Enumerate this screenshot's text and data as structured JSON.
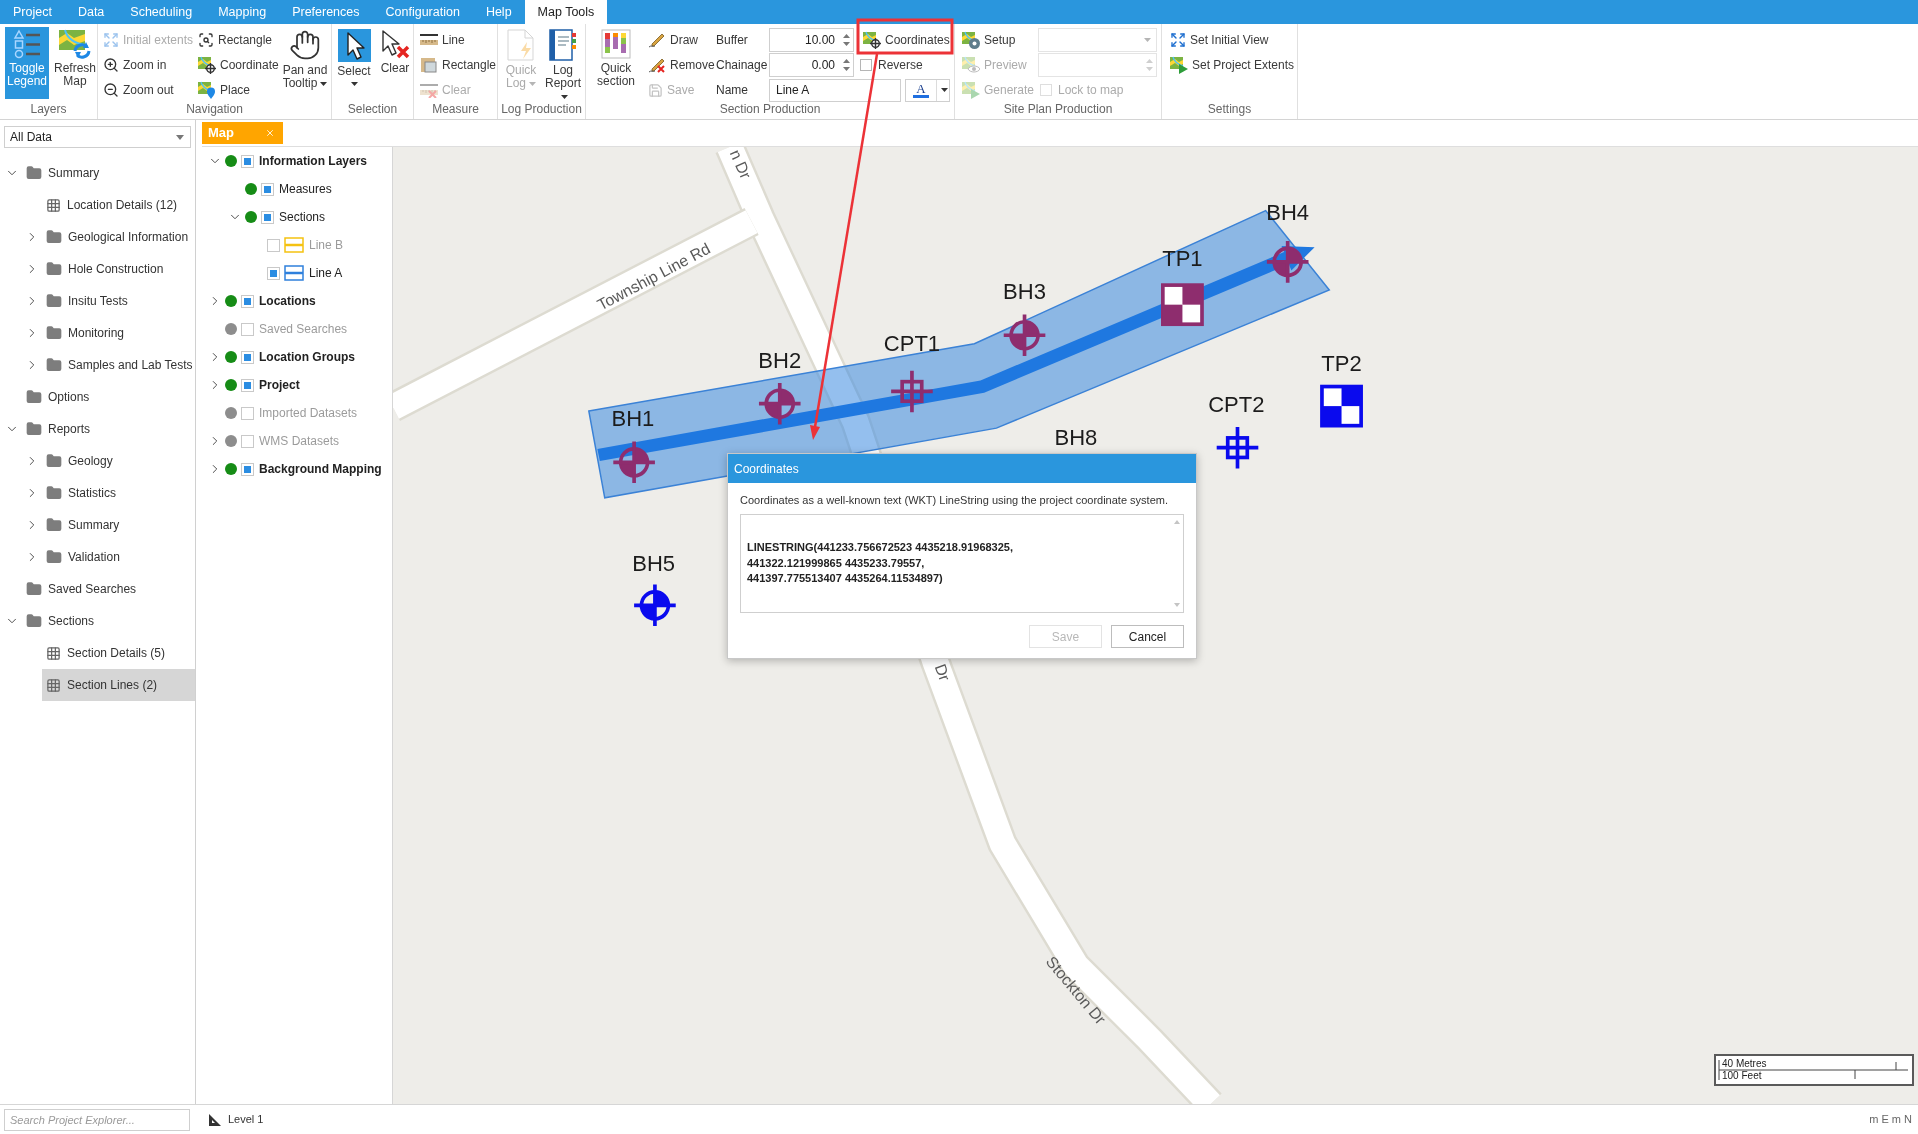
{
  "menu_tabs": [
    {
      "label": "Project",
      "selected": false
    },
    {
      "label": "Data",
      "selected": false
    },
    {
      "label": "Scheduling",
      "selected": false
    },
    {
      "label": "Mapping",
      "selected": false
    },
    {
      "label": "Preferences",
      "selected": false
    },
    {
      "label": "Configuration",
      "selected": false
    },
    {
      "label": "Help",
      "selected": false
    },
    {
      "label": "Map Tools",
      "selected": true
    }
  ],
  "ribbon": {
    "layers": {
      "label": "Layers",
      "toggle_legend": {
        "label": "Toggle Legend",
        "selected": true
      },
      "refresh_map": {
        "label": "Refresh Map"
      }
    },
    "navigation": {
      "label": "Navigation",
      "initial_extents": {
        "label": "Initial extents",
        "disabled": true
      },
      "zoom_in": {
        "label": "Zoom in"
      },
      "zoom_out": {
        "label": "Zoom out"
      },
      "rectangle": {
        "label": "Rectangle"
      },
      "coordinate": {
        "label": "Coordinate"
      },
      "place": {
        "label": "Place"
      },
      "pan_and_tooltip": {
        "label": "Pan and Tooltip"
      }
    },
    "selection": {
      "label": "Selection",
      "select": {
        "label": "Select",
        "selected": true
      },
      "clear": {
        "label": "Clear"
      }
    },
    "measure": {
      "label": "Measure",
      "line": {
        "label": "Line"
      },
      "rectangle": {
        "label": "Rectangle"
      },
      "clear": {
        "label": "Clear",
        "disabled": true
      }
    },
    "log_production": {
      "label": "Log Production",
      "quick_log": {
        "label": "Quick Log",
        "disabled": true
      },
      "log_report": {
        "label": "Log Report"
      }
    },
    "section_production": {
      "label": "Section Production",
      "quick_section": {
        "label": "Quick section"
      },
      "draw": {
        "label": "Draw"
      },
      "remove": {
        "label": "Remove"
      },
      "save": {
        "label": "Save",
        "disabled": true
      },
      "buffer": {
        "label": "Buffer",
        "value": "10.00"
      },
      "chainage": {
        "label": "Chainage",
        "value": "0.00"
      },
      "name": {
        "label": "Name",
        "value": "Line A"
      },
      "font_color": {
        "label": "A"
      },
      "coordinates": {
        "label": "Coordinates"
      },
      "reverse": {
        "label": "Reverse",
        "checked": false
      }
    },
    "site_plan_production": {
      "label": "Site Plan Production",
      "setup": {
        "label": "Setup"
      },
      "preview": {
        "label": "Preview",
        "disabled": true
      },
      "generate": {
        "label": "Generate",
        "disabled": true
      },
      "dropdown": {
        "disabled": true
      },
      "number_field": {
        "disabled": true
      },
      "lock_to_map": {
        "label": "Lock to map",
        "checked": false,
        "disabled": true
      }
    },
    "settings": {
      "label": "Settings",
      "set_initial_view": {
        "label": "Set Initial View"
      },
      "set_project_extents": {
        "label": "Set Project Extents"
      }
    }
  },
  "explorer": {
    "filter": {
      "value": "All Data"
    },
    "tree": [
      {
        "label": "Summary",
        "kind": "folder",
        "selected": false,
        "expanded": true,
        "children": [
          {
            "label": "Location Details (12)",
            "kind": "table",
            "selected": false
          },
          {
            "label": "Geological Information",
            "kind": "folder",
            "selected": false,
            "expanded": false
          },
          {
            "label": "Hole Construction",
            "kind": "folder",
            "selected": false,
            "expanded": false
          },
          {
            "label": "Insitu Tests",
            "kind": "folder",
            "selected": false,
            "expanded": false
          },
          {
            "label": "Monitoring",
            "kind": "folder",
            "selected": false,
            "expanded": false
          },
          {
            "label": "Samples and Lab Tests",
            "kind": "folder",
            "selected": false,
            "expanded": false
          }
        ]
      },
      {
        "label": "Options",
        "kind": "folder",
        "selected": false
      },
      {
        "label": "Reports",
        "kind": "folder",
        "selected": false,
        "expanded": true,
        "children": [
          {
            "label": "Geology",
            "kind": "folder",
            "selected": false,
            "expanded": false
          },
          {
            "label": "Statistics",
            "kind": "folder",
            "selected": false,
            "expanded": false
          },
          {
            "label": "Summary",
            "kind": "folder",
            "selected": false,
            "expanded": false
          },
          {
            "label": "Validation",
            "kind": "folder",
            "selected": false,
            "expanded": false
          }
        ]
      },
      {
        "label": "Saved Searches",
        "kind": "folder",
        "selected": false
      },
      {
        "label": "Sections",
        "kind": "folder",
        "selected": false,
        "expanded": true,
        "children": [
          {
            "label": "Section Details (5)",
            "kind": "table",
            "selected": false
          },
          {
            "label": "Section Lines (2)",
            "kind": "table",
            "selected": true
          }
        ]
      }
    ]
  },
  "document_tabs": [
    {
      "label": "Map",
      "selected": true
    }
  ],
  "layers": [
    {
      "label": "Information Layers",
      "visible": true,
      "checked": true,
      "expanded": true,
      "children": [
        {
          "label": "Measures",
          "visible": true,
          "checked": true
        },
        {
          "label": "Sections",
          "visible": true,
          "checked": true,
          "expanded": true,
          "children": [
            {
              "label": "Line B",
              "checked": false,
              "color": "#f5c211"
            },
            {
              "label": "Line A",
              "checked": true,
              "color": "#2f80dc"
            }
          ]
        }
      ]
    },
    {
      "label": "Locations",
      "visible": true,
      "checked": true,
      "expanded": false
    },
    {
      "label": "Saved Searches",
      "visible": false,
      "checked": false
    },
    {
      "label": "Location Groups",
      "visible": true,
      "checked": true,
      "expanded": false
    },
    {
      "label": "Project",
      "visible": true,
      "checked": true,
      "expanded": false
    },
    {
      "label": "Imported Datasets",
      "visible": false,
      "checked": false
    },
    {
      "label": "WMS Datasets",
      "visible": false,
      "checked": false,
      "expanded": false
    },
    {
      "label": "Background Mapping",
      "visible": true,
      "checked": true,
      "expanded": false
    }
  ],
  "map": {
    "road_labels": [
      "n Dr",
      "Township Line Rd",
      "Dr",
      "Stockton Dr"
    ],
    "markers": [
      {
        "label": "BH1",
        "kind": "borehole",
        "color": "#8e2d6e"
      },
      {
        "label": "BH2",
        "kind": "borehole",
        "color": "#8e2d6e"
      },
      {
        "label": "CPT1",
        "kind": "cpt",
        "color": "#8e2d6e"
      },
      {
        "label": "BH3",
        "kind": "borehole",
        "color": "#8e2d6e"
      },
      {
        "label": "TP1",
        "kind": "trial_pit",
        "color": "#8e2d6e"
      },
      {
        "label": "BH4",
        "kind": "borehole",
        "color": "#8e2d6e"
      },
      {
        "label": "TP2",
        "kind": "trial_pit",
        "color": "#0a0aee"
      },
      {
        "label": "CPT2",
        "kind": "cpt",
        "color": "#0a0aee"
      },
      {
        "label": "BH8"
      },
      {
        "label": "BH5",
        "kind": "borehole",
        "color": "#0a0aee"
      }
    ],
    "scale_bar": {
      "metric": "40 Metres",
      "imperial": "100 Feet"
    }
  },
  "dialog": {
    "title": "Coordinates",
    "description": "Coordinates as a well-known text (WKT) LineString using the project coordinate system.",
    "value": "LINESTRING(441233.756672523 4435218.91968325,\n441322.121999865 4435233.79557,\n441397.775513407 4435264.11534897)",
    "buttons": [
      {
        "label": "Save",
        "disabled": true
      },
      {
        "label": "Cancel",
        "disabled": false
      }
    ]
  },
  "status_bar": {
    "search": {
      "placeholder": "Search Project Explorer..."
    },
    "map_level": "Level 1",
    "units": "m E m N"
  }
}
